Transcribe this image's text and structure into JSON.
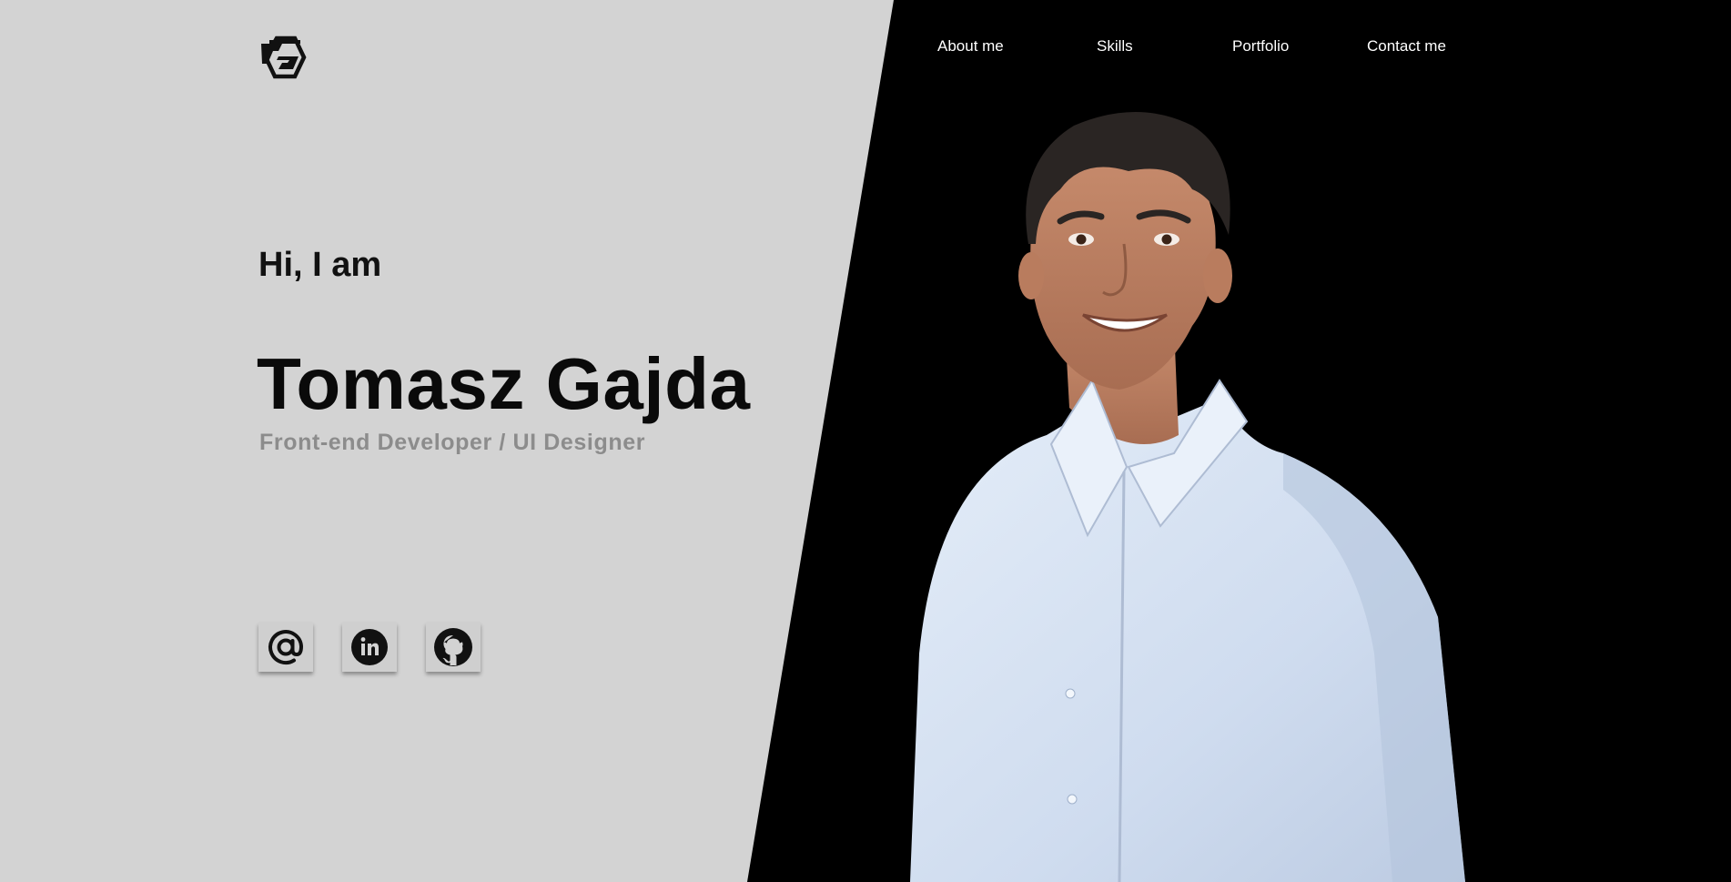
{
  "brand": {
    "logo_icon": "tg-monogram-logo"
  },
  "nav": {
    "items": [
      {
        "label": "About me"
      },
      {
        "label": "Skills"
      },
      {
        "label": "Portfolio"
      },
      {
        "label": "Contact me"
      }
    ]
  },
  "hero": {
    "greeting": "Hi, I am",
    "name": "Tomasz Gajda",
    "role": "Front-end Developer / UI Designer"
  },
  "socials": [
    {
      "icon": "at-sign-icon"
    },
    {
      "icon": "linkedin-icon"
    },
    {
      "icon": "github-icon"
    }
  ],
  "colors": {
    "left_background": "#d3d3d3",
    "right_background": "#000000",
    "role_text": "#8c8c8c",
    "nav_text": "#ffffff"
  }
}
